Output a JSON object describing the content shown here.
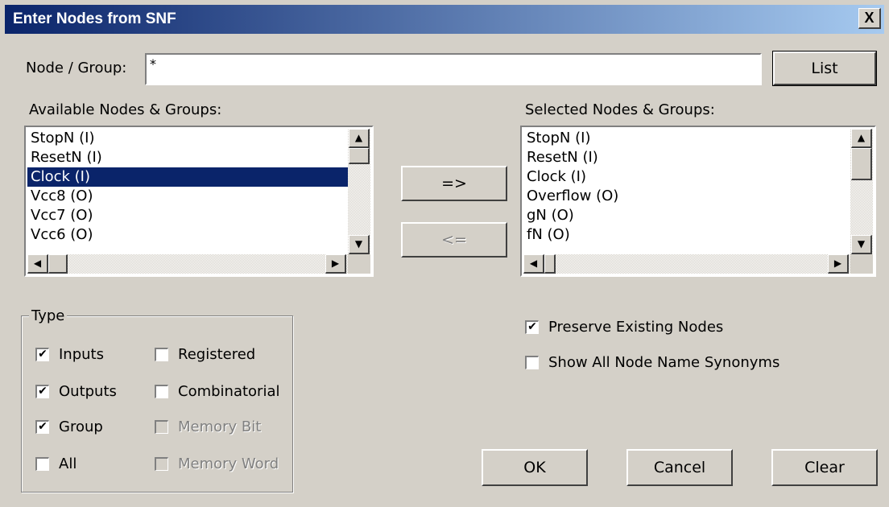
{
  "window": {
    "title": "Enter Nodes from SNF",
    "close_glyph": "X"
  },
  "node_group": {
    "label": "Node / Group:",
    "value": "*",
    "list_button": "List"
  },
  "available": {
    "label": "Available Nodes & Groups:",
    "items": [
      "StopN (I)",
      "ResetN (I)",
      "Clock (I)",
      "Vcc8 (O)",
      "Vcc7 (O)",
      "Vcc6 (O)"
    ],
    "selected_index": 2
  },
  "selected": {
    "label": "Selected Nodes & Groups:",
    "items": [
      "StopN (I)",
      "ResetN (I)",
      "Clock (I)",
      "Overflow (O)",
      "gN (O)",
      "fN (O)"
    ]
  },
  "move": {
    "add_label": "=>",
    "remove_label": "<="
  },
  "type": {
    "title": "Type",
    "inputs": {
      "label": "Inputs",
      "checked": true
    },
    "outputs": {
      "label": "Outputs",
      "checked": true
    },
    "group": {
      "label": "Group",
      "checked": true
    },
    "all": {
      "label": "All",
      "checked": false
    },
    "registered": {
      "label": "Registered",
      "checked": false
    },
    "combinatorial": {
      "label": "Combinatorial",
      "checked": false
    },
    "memory_bit": {
      "label": "Memory Bit",
      "checked": false
    },
    "memory_word": {
      "label": "Memory Word",
      "checked": false
    }
  },
  "options": {
    "preserve": {
      "label": "Preserve Existing Nodes",
      "checked": true
    },
    "synonyms": {
      "label": "Show All Node Name Synonyms",
      "checked": false
    }
  },
  "buttons": {
    "ok": "OK",
    "cancel": "Cancel",
    "clear": "Clear"
  },
  "icons": {
    "scroll_up": "▲",
    "scroll_down": "▼",
    "scroll_left": "◀",
    "scroll_right": "▶",
    "check": "✔"
  }
}
